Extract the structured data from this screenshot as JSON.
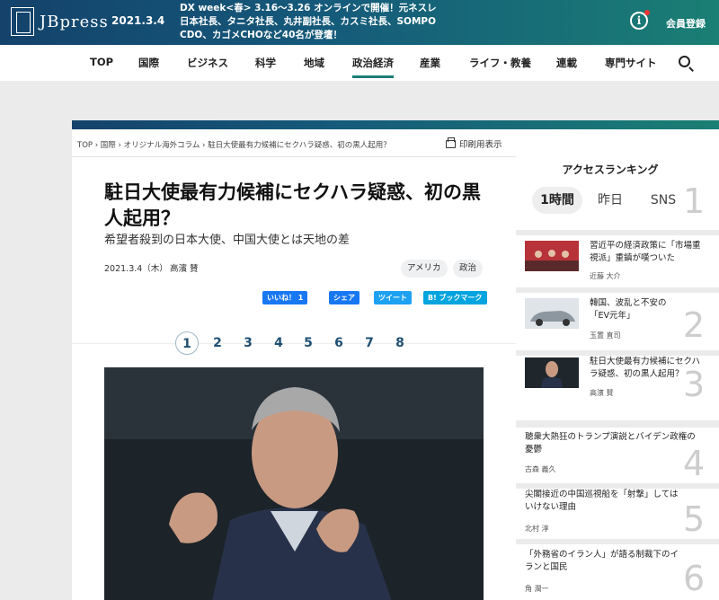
{
  "header": {
    "logo_text": "JBpress",
    "date": "2021.3.4",
    "ticker": "DX week<春> 3.16〜3.26 オンラインで開催！元ネスレ日本社長、タニタ社長、丸井副社長、カスミ社長、SOMPO CDO、カゴメCHOなど40名が登壇！",
    "member_label": "会員登録"
  },
  "nav": {
    "items": [
      "TOP",
      "国際",
      "ビジネス",
      "科学",
      "地域",
      "政治経済",
      "産業",
      "ライフ・教養",
      "連載",
      "専門サイト"
    ],
    "active": "政治経済"
  },
  "article": {
    "breadcrumb": "TOP ›  国際  ›  オリジナル海外コラム  ›  駐日大使最有力候補にセクハラ疑惑、初の黒人起用？",
    "print_label": "印刷用表示",
    "title": "駐日大使最有力候補にセクハラ疑惑、初の黒人起用？",
    "subtitle": "希望者殺到の日本大使、中国大使とは天地の差",
    "date": "2021.3.4（木）",
    "author": "高濱 賛",
    "tags": [
      "アメリカ",
      "政治"
    ],
    "share": {
      "like": "いいね！ 1",
      "facebook_share": "シェア",
      "tweet": "ツイート",
      "bookmark": "B! ブックマーク"
    },
    "pages": [
      "1",
      "2",
      "3",
      "4",
      "5",
      "6",
      "7",
      "8"
    ],
    "current_page": "1"
  },
  "sidebar": {
    "title": "アクセスランキング",
    "tabs": [
      "1時間",
      "昨日",
      "SNS"
    ],
    "active_tab": "1時間",
    "items": [
      {
        "rank": "1",
        "text": "習近平の経済政策に「市場重視派」重鎮が嘆ついた",
        "author": "近藤 大介"
      },
      {
        "rank": "2",
        "text": "韓国、波乱と不安の「EV元年」",
        "author": "玉置 直司"
      },
      {
        "rank": "3",
        "text": "駐日大使最有力候補にセクハラ疑惑、初の黒人起用？",
        "author": "高濱 賛"
      },
      {
        "rank": "4",
        "text": "聴衆大熱狂のトランプ演説とバイデン政権の憂鬱",
        "author": "古森 義久"
      },
      {
        "rank": "5",
        "text": "尖閣接近の中国巡視船を「射撃」してはいけない理由",
        "author": "北村 淳"
      },
      {
        "rank": "6",
        "text": "「外務省のイラン人」が語る制裁下のイランと国民",
        "author": "角 潤一"
      }
    ]
  },
  "colors": {
    "header_start": "#14426b",
    "header_end": "#1a7f74",
    "facebook": "#1877f2",
    "twitter": "#1da1f2",
    "hatena": "#00a4de"
  }
}
